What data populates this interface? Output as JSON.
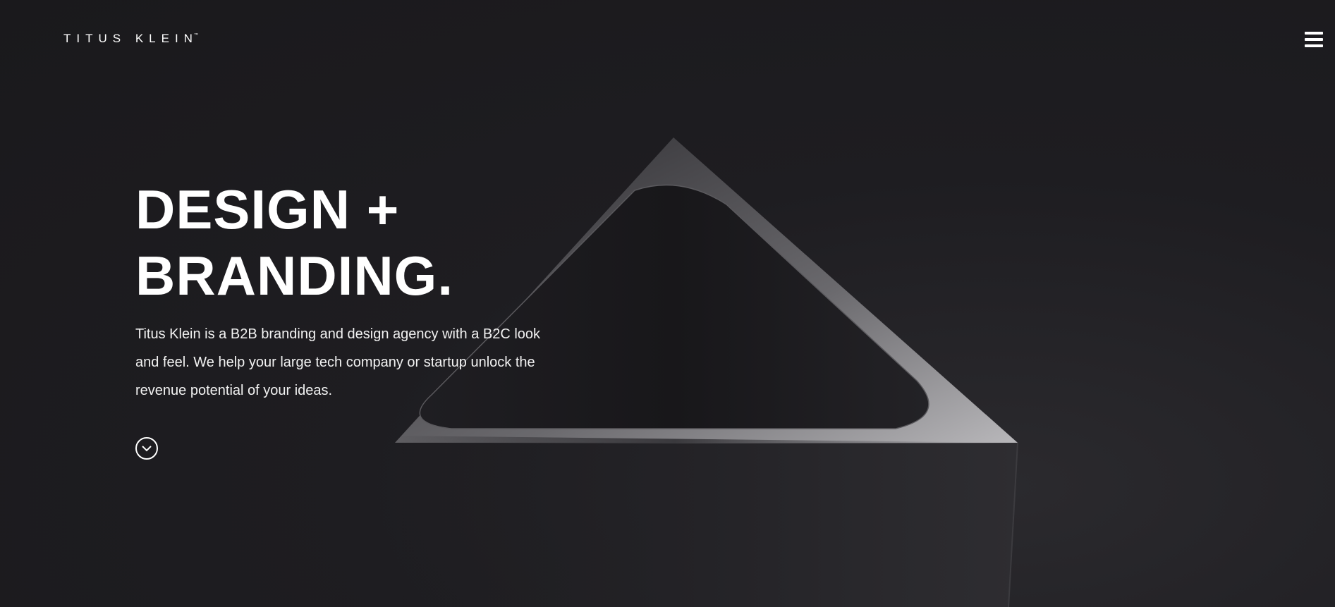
{
  "header": {
    "logo_text": "TITUS KLEIN",
    "logo_mark": "™",
    "menu_icon": "hamburger-menu-icon"
  },
  "hero": {
    "headline_line1": "DESIGN +",
    "headline_line2": "BRANDING.",
    "description": "Titus Klein is a B2B branding and design agency with a B2C look and feel. We help your large tech company or startup unlock the revenue potential of your ideas.",
    "scroll_icon": "chevron-down-circle-icon"
  },
  "colors": {
    "background": "#1c1b1e",
    "text": "#ffffff"
  }
}
